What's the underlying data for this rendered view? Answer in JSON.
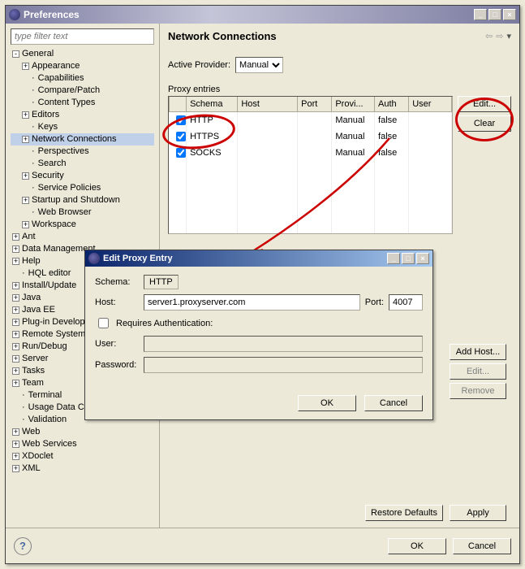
{
  "window": {
    "title": "Preferences",
    "filter_placeholder": "type filter text"
  },
  "tree": {
    "general": "General",
    "general_items": [
      "Appearance",
      "Capabilities",
      "Compare/Patch",
      "Content Types",
      "Editors",
      "Keys",
      "Network Connections",
      "Perspectives",
      "Search",
      "Security",
      "Service Policies",
      "Startup and Shutdown",
      "Web Browser",
      "Workspace"
    ],
    "general_expandable": {
      "Appearance": true,
      "Editors": true,
      "Network Connections": true,
      "Security": true,
      "Startup and Shutdown": true,
      "Workspace": true
    },
    "top": [
      "Ant",
      "Data Management",
      "Help",
      "HQL editor",
      "Install/Update",
      "Java",
      "Java EE",
      "Plug-in Development",
      "Remote Systems",
      "Run/Debug",
      "Server",
      "Tasks",
      "Team",
      "Terminal",
      "Usage Data Collector",
      "Validation",
      "Web",
      "Web Services",
      "XDoclet",
      "XML"
    ],
    "top_expandable": {
      "Ant": true,
      "Data Management": true,
      "Help": true,
      "Install/Update": true,
      "Java": true,
      "Java EE": true,
      "Plug-in Development": true,
      "Remote Systems": true,
      "Run/Debug": true,
      "Server": true,
      "Tasks": true,
      "Team": true,
      "Web": true,
      "Web Services": true,
      "XDoclet": true,
      "XML": true
    }
  },
  "page": {
    "title": "Network Connections",
    "active_provider_label": "Active Provider:",
    "active_provider_value": "Manual",
    "proxy_entries_label": "Proxy entries",
    "columns": [
      "",
      "Schema",
      "Host",
      "Port",
      "Provi...",
      "Auth",
      "User"
    ],
    "rows": [
      {
        "checked": true,
        "schema": "HTTP",
        "host": "",
        "port": "",
        "provider": "Manual",
        "auth": "false",
        "user": ""
      },
      {
        "checked": true,
        "schema": "HTTPS",
        "host": "",
        "port": "",
        "provider": "Manual",
        "auth": "false",
        "user": ""
      },
      {
        "checked": true,
        "schema": "SOCKS",
        "host": "",
        "port": "",
        "provider": "Manual",
        "auth": "false",
        "user": ""
      }
    ],
    "btn_edit": "Edit...",
    "btn_clear": "Clear",
    "btn_addhost": "Add Host...",
    "btn_edit2": "Edit...",
    "btn_remove": "Remove",
    "btn_restore": "Restore Defaults",
    "btn_apply": "Apply",
    "btn_ok": "OK",
    "btn_cancel": "Cancel"
  },
  "dialog": {
    "title": "Edit Proxy Entry",
    "schema_label": "Schema:",
    "schema_value": "HTTP",
    "host_label": "Host:",
    "host_value": "server1.proxyserver.com",
    "port_label": "Port:",
    "port_value": "4007",
    "requires_auth_label": "Requires Authentication:",
    "user_label": "User:",
    "password_label": "Password:",
    "btn_ok": "OK",
    "btn_cancel": "Cancel"
  }
}
